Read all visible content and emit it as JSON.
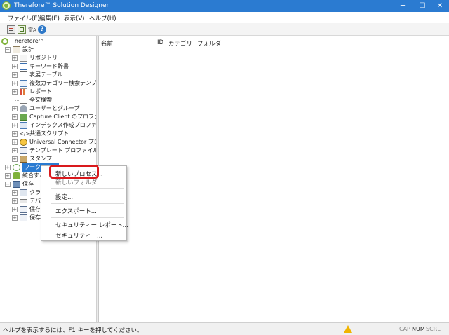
{
  "window": {
    "title": "Therefore™ Solution Designer",
    "minimize_glyph": "─",
    "maximize_glyph": "☐",
    "close_glyph": "✕"
  },
  "menu": [
    "ファイル(F)",
    "編集(E)",
    "表示(V)",
    "ヘルプ(H)"
  ],
  "toolbar": {
    "icons": [
      "properties-icon",
      "designer-icon",
      "help-icon"
    ],
    "small_label": "富A"
  },
  "tree": {
    "root": "Therefore™",
    "design": {
      "label": "設計",
      "items": [
        "リポジトリ",
        "キーワード辞書",
        "表展テーブル",
        "複数カテゴリー検索テンプレー",
        "レポート",
        "全文検索",
        "ユーザーとグループ",
        "Capture Client のプロファイル",
        "インデックス作成プロファイル",
        "共通スクリプト",
        "Universal Connector プロファ",
        "テンプレート プロファイル",
        "スタンプ"
      ]
    },
    "workflow": "ワークフロー",
    "integration": "統合する",
    "storage": {
      "label": "保存",
      "items": [
        "クラ",
        "デバ",
        "保存",
        "保存"
      ]
    }
  },
  "list": {
    "columns": [
      "名前",
      "ID",
      "カテゴリー",
      "フォルダー"
    ]
  },
  "context_menu": {
    "items": [
      "新しいプロセス...",
      "新しいフォルダー",
      "設定...",
      "エクスポート...",
      "セキュリティー レポート...",
      "セキュリティー..."
    ],
    "highlight_color": "#d9191c"
  },
  "statusbar": {
    "text": "ヘルプを表示するには、F1 キーを押してください。",
    "indicators": [
      "CAP",
      "NUM",
      "SCRL"
    ]
  },
  "colors": {
    "titlebar": "#2b7bd1",
    "selection": "#cce4f7",
    "brand_green": "#7fb23a"
  }
}
